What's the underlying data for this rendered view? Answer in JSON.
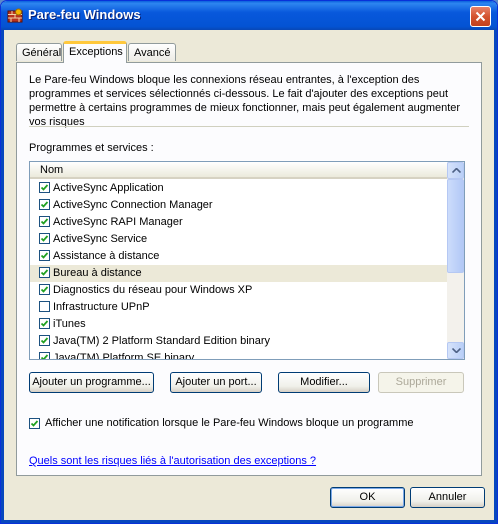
{
  "window": {
    "title": "Pare-feu Windows"
  },
  "tabs": [
    {
      "label": "Général"
    },
    {
      "label": "Exceptions"
    },
    {
      "label": "Avancé"
    }
  ],
  "exceptions": {
    "description": "Le Pare-feu Windows bloque les connexions réseau entrantes, à l'exception des programmes et services sélectionnés ci-dessous. Le fait d'ajouter des exceptions peut permettre à certains programmes de mieux fonctionner, mais peut également augmenter vos risques",
    "list_label": "Programmes et services :",
    "column_header": "Nom",
    "items": [
      {
        "label": "ActiveSync Application",
        "checked": true
      },
      {
        "label": "ActiveSync Connection Manager",
        "checked": true
      },
      {
        "label": "ActiveSync RAPI Manager",
        "checked": true
      },
      {
        "label": "ActiveSync Service",
        "checked": true
      },
      {
        "label": "Assistance à distance",
        "checked": true
      },
      {
        "label": "Bureau à distance",
        "checked": true,
        "selected": true
      },
      {
        "label": "Diagnostics du réseau pour Windows XP",
        "checked": true
      },
      {
        "label": "Infrastructure UPnP",
        "checked": false
      },
      {
        "label": "iTunes",
        "checked": true
      },
      {
        "label": "Java(TM) 2 Platform Standard Edition binary",
        "checked": true
      },
      {
        "label": "Java(TM) Platform SE binary",
        "checked": true
      }
    ],
    "buttons": {
      "add_program": "Ajouter un programme...",
      "add_port": "Ajouter un port...",
      "modify": "Modifier...",
      "delete": "Supprimer"
    },
    "notify": {
      "label": "Afficher une notification lorsque le Pare-feu Windows bloque un programme",
      "checked": true
    },
    "risk_link": "Quels sont les risques liés à l'autorisation des exceptions ?"
  },
  "footer": {
    "ok": "OK",
    "cancel": "Annuler"
  },
  "icons": {
    "title": "firewall-icon",
    "close": "close-icon",
    "scroll_up": "scroll-up-arrow-icon",
    "scroll_down": "scroll-down-arrow-icon",
    "check": "checkmark-icon"
  },
  "colors": {
    "title_bar": "#0A5FDD",
    "dialog_bg": "#ECE9D8",
    "active_tab_accent": "#FFC83C",
    "link": "#0000FF"
  }
}
